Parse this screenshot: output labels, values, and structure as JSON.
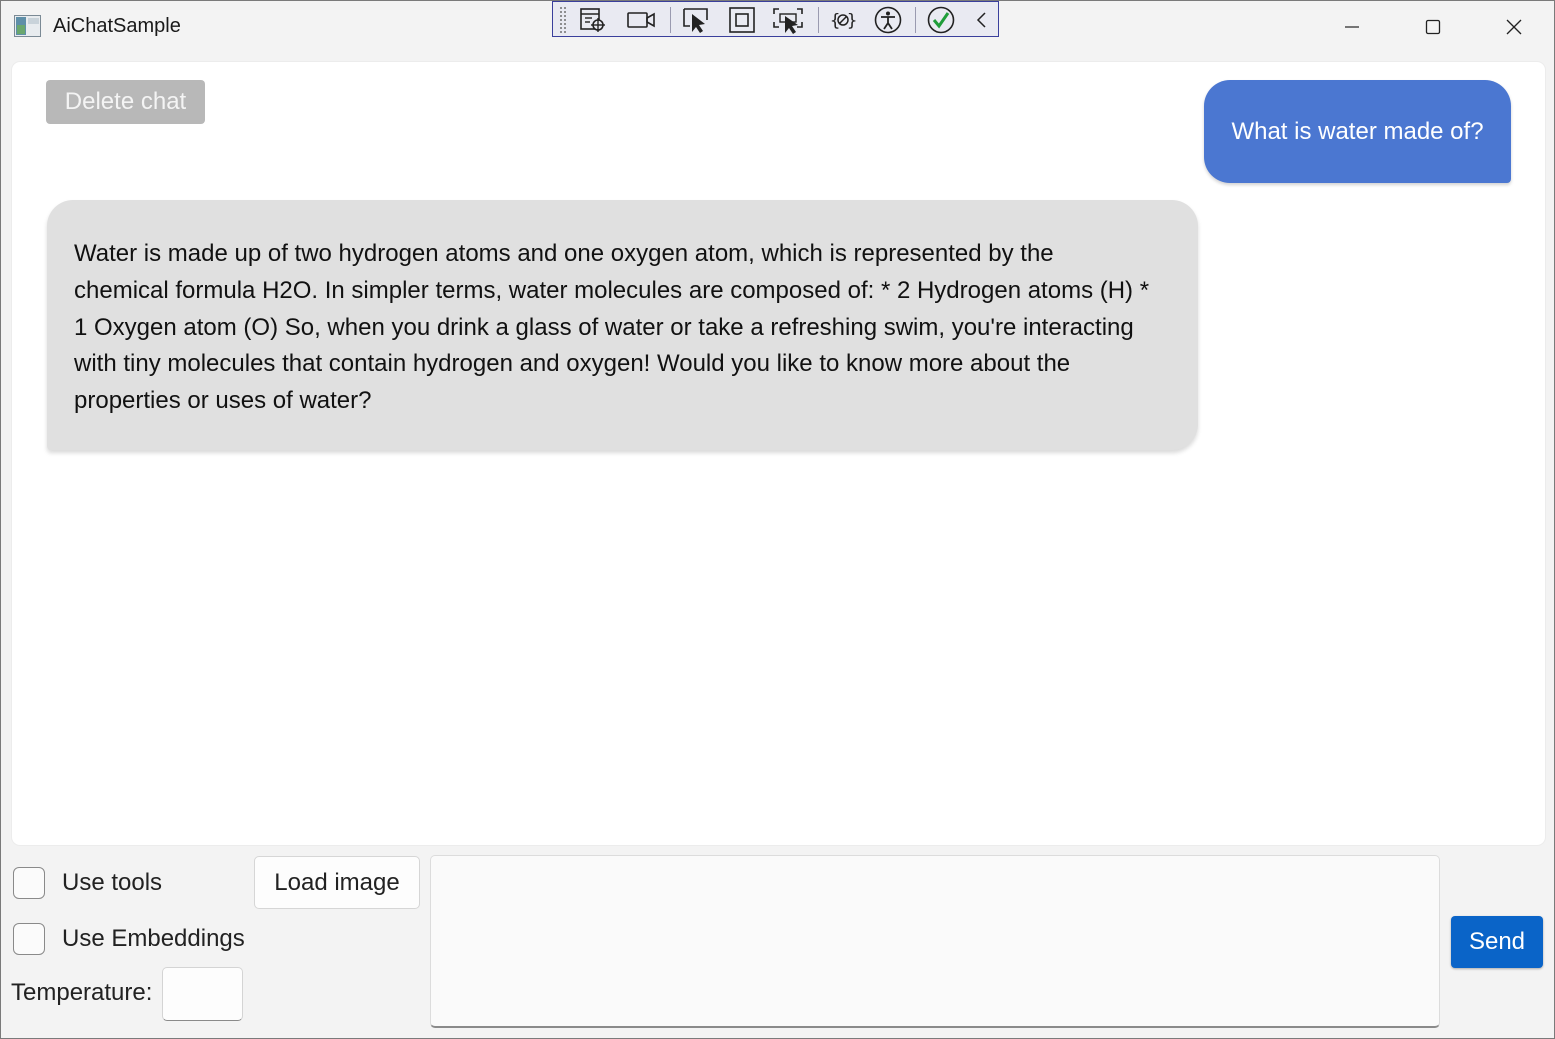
{
  "window": {
    "title": "AiChatSample",
    "controls": [
      "minimize",
      "maximize",
      "close"
    ]
  },
  "debug_toolbar": {
    "icons": [
      "grip-icon",
      "live-visual-tree-icon",
      "record-icon",
      "select-element-icon",
      "display-layout-adorners-icon",
      "track-focus-icon",
      "binding-failures-icon",
      "accessibility-icon",
      "check-icon",
      "collapse-icon"
    ]
  },
  "chat": {
    "delete_label": "Delete chat",
    "messages": [
      {
        "role": "user",
        "text": "What is water made of?"
      },
      {
        "role": "assistant",
        "lines": [
          "Water is made up of two hydrogen atoms and one oxygen atom, which is represented by the",
          "chemical formula H2O. In simpler terms, water molecules are composed of: * 2 Hydrogen atoms (H) *",
          "1 Oxygen atom (O) So, when you drink a glass of water or take a refreshing swim, you're interacting",
          "with tiny molecules that contain hydrogen and oxygen! Would you like to know more about the",
          "properties or uses of water?"
        ]
      }
    ]
  },
  "controls": {
    "use_tools_label": "Use tools",
    "use_tools_checked": false,
    "use_embeddings_label": "Use Embeddings",
    "use_embeddings_checked": false,
    "load_image_label": "Load image",
    "temperature_label": "Temperature:",
    "temperature_value": "",
    "prompt_value": "",
    "send_label": "Send"
  },
  "colors": {
    "user_bubble": "#4b77d1",
    "assistant_bubble": "#e0e0e0",
    "send_button": "#0a64c8",
    "delete_button_disabled": "#b8b8b8"
  }
}
